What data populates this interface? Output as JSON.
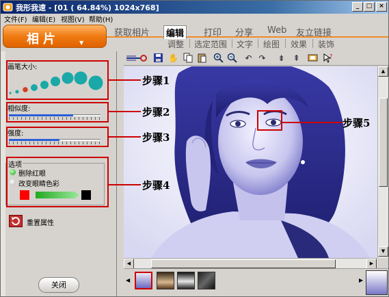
{
  "window": {
    "title": "我形我速 - [01 ( 64.84%) 1024x768]",
    "controls": {
      "minimize": "_",
      "maximize": "□",
      "close": "×"
    }
  },
  "menu": [
    "文件(F)",
    "编辑(E)",
    "视图(V)",
    "帮助(H)"
  ],
  "nav": {
    "mode_tab": "相片",
    "tabs": [
      "获取相片",
      "编辑",
      "打印",
      "分享",
      "Web",
      "友立链接"
    ],
    "active_tab": "编辑",
    "subtabs": [
      "调整",
      "选定范围",
      "文字",
      "绘图",
      "效果",
      "装饰"
    ]
  },
  "left_panel": {
    "brush_size_label": "画笔大小:",
    "similarity_label": "相似度:",
    "similarity_value": 0.7,
    "intensity_label": "强度:",
    "intensity_value": 0.55,
    "options_label": "选项",
    "option1": "删除红眼",
    "option2": "改变眼睛色彩",
    "reset_label": "重置属性",
    "close_label": "关闭",
    "colors": {
      "eye_color": "#ff0000",
      "gradient_start": "#22aa22",
      "swatch2": "#000000"
    }
  },
  "annotations": {
    "step1": "步骤1",
    "step2": "步骤2",
    "step3": "步骤3",
    "step4": "步骤4",
    "step5": "步骤5"
  },
  "accent": {
    "orange": "#f07a12",
    "callout_red": "#cc0000",
    "photo_tint": "#3a3aa0"
  }
}
